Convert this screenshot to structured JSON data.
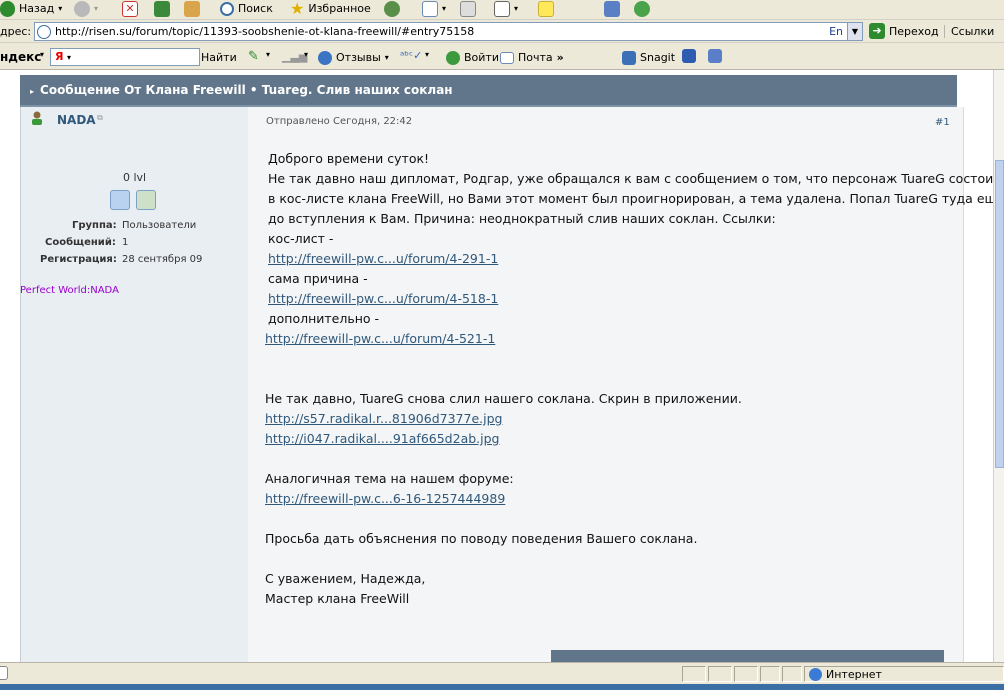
{
  "toolbar": {
    "back_label": "Назад",
    "search_label": "Поиск",
    "favorites_label": "Избранное"
  },
  "addressbar": {
    "label": "дрес:",
    "url": "http://risen.su/forum/topic/11393-soobshenie-ot-klana-freewill/#entry75158",
    "lang": "En",
    "go_label": "Переход",
    "links_label": "Ссылки"
  },
  "yandex": {
    "brand": "ндекс",
    "input_value": "Я",
    "find_label": "Найти",
    "reviews_label": "Отзывы",
    "login_label": "Войти",
    "mail_label": "Почта",
    "snagit_label": "Snagit"
  },
  "post": {
    "title": "Сообщение От Клана Freewill • Tuareg. Слив наших соклан",
    "author": "NADA",
    "level": "0 lvl",
    "group_label": "Группа:",
    "group_value": "Пользователи",
    "messages_label": "Сообщений:",
    "messages_value": "1",
    "registration_label": "Регистрация:",
    "registration_value": "28 сентября 09",
    "signature": "Perfect World:NADA",
    "posted": "Отправлено Сегодня, 22:42",
    "number": "#1",
    "lines": [
      "Доброго времени суток!",
      "Не так давно наш дипломат, Родгар, уже обращался к вам с сообщением о том, что персонаж TuareG состоит",
      "в кос-листе клана FreeWill, но Вами этот момент был проигнорирован, а тема удалена. Попал TuareG туда еще",
      "до вступления к Вам. Причина: неоднократный слив наших соклан. Ссылки:",
      "кос-лист -",
      "http://freewill-pw.c...u/forum/4-291-1",
      "сама причина -",
      "http://freewill-pw.c...u/forum/4-518-1",
      "дополнительно -",
      "http://freewill-pw.c...u/forum/4-521-1",
      "Не так давно, TuareG снова слил нашего соклана. Скрин в приложении.",
      "http://s57.radikal.r...81906d7377e.jpg",
      "http://i047.radikal....91af665d2ab.jpg",
      "Аналогичная тема на нашем форуме:",
      "http://freewill-pw.c...6-16-1257444989",
      "Просьба дать объяснения по поводу поведения Вашего соклана.",
      "С уважением, Надежда,",
      "Мастер клана FreeWill"
    ]
  },
  "status": {
    "zone": "Интернет"
  },
  "colors": {
    "header_bg": "#61768a",
    "link": "#30587a",
    "signature": "#9900cc"
  }
}
